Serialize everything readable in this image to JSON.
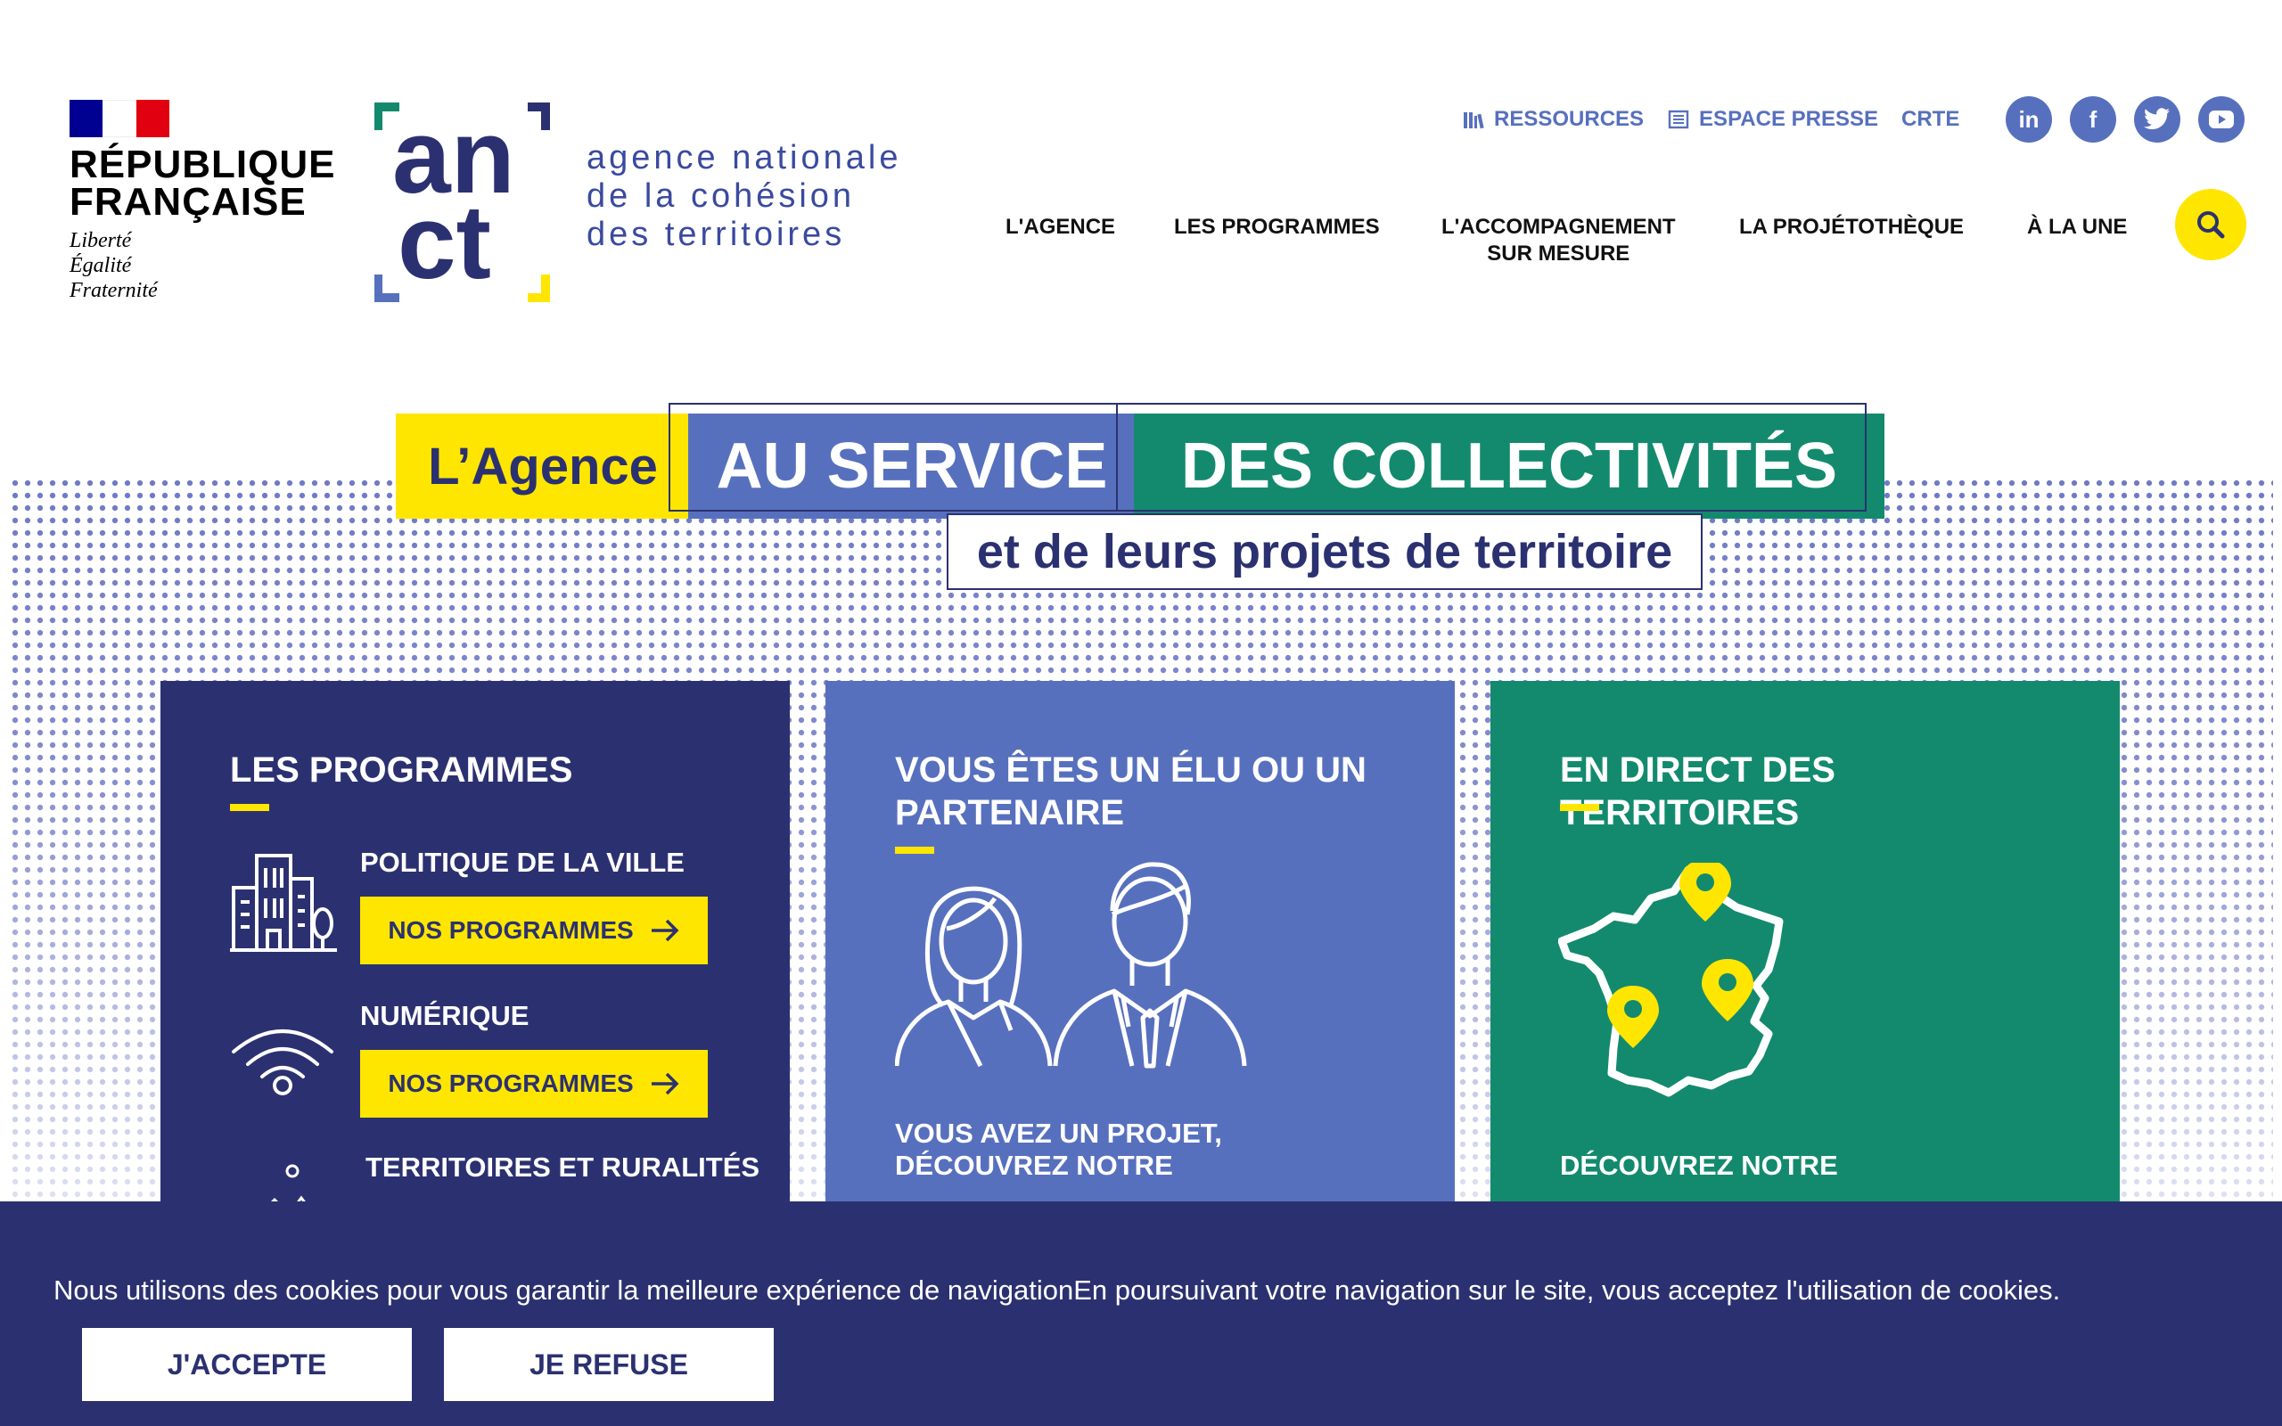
{
  "republique": {
    "title_line1": "RÉPUBLIQUE",
    "title_line2": "FRANÇAISE",
    "motto_1": "Liberté",
    "motto_2": "Égalité",
    "motto_3": "Fraternité",
    "flag_colors": [
      "#000091",
      "#ffffff",
      "#e1000f"
    ]
  },
  "anct": {
    "line1": "agence nationale",
    "line2": "de la cohésion",
    "line3": "des territoires",
    "brand_colors": {
      "navy": "#2b3170",
      "blue": "#5770be",
      "green": "#138a6e",
      "yellow": "#ffe600"
    }
  },
  "top_links": [
    {
      "label": "RESSOURCES",
      "icon": "books-icon"
    },
    {
      "label": "ESPACE PRESSE",
      "icon": "newspaper-icon"
    },
    {
      "label": "CRTE",
      "icon": ""
    }
  ],
  "socials": [
    {
      "name": "linkedin-icon",
      "glyph": "in"
    },
    {
      "name": "facebook-icon",
      "glyph": "f"
    },
    {
      "name": "twitter-icon",
      "glyph": ""
    },
    {
      "name": "youtube-icon",
      "glyph": ""
    }
  ],
  "nav": {
    "agence": "L'AGENCE",
    "programmes": "LES PROGRAMMES",
    "accomp_1": "L'ACCOMPAGNEMENT",
    "accomp_2": "SUR MESURE",
    "projetotheque": "LA PROJÉTOTHÈQUE",
    "alaune": "À LA UNE"
  },
  "hero": {
    "tag_agence": "L’Agence",
    "tag_service": "AU SERVICE",
    "tag_collectivites": "DES COLLECTIVITÉS",
    "subtitle": "et de leurs projets de territoire"
  },
  "cards": {
    "programmes": {
      "title": "LES PROGRAMMES",
      "items": [
        {
          "title": "POLITIQUE DE LA VILLE",
          "button": "NOS PROGRAMMES"
        },
        {
          "title": "NUMÉRIQUE",
          "button": "NOS PROGRAMMES"
        },
        {
          "title": "TERRITOIRES ET RURALITÉS"
        }
      ]
    },
    "elu": {
      "title": "VOUS ÊTES UN ÉLU OU UN PARTENAIRE",
      "footer": "VOUS AVEZ UN PROJET, DÉCOUVREZ NOTRE"
    },
    "direct": {
      "title": "EN DIRECT DES TERRITOIRES",
      "footer": "DÉCOUVREZ NOTRE"
    }
  },
  "cookie": {
    "text": "Nous utilisons des cookies pour vous garantir la meilleure expérience de navigationEn poursuivant votre navigation sur le site, vous acceptez l'utilisation de cookies.",
    "accept": "J'ACCEPTE",
    "refuse": "JE REFUSE"
  }
}
